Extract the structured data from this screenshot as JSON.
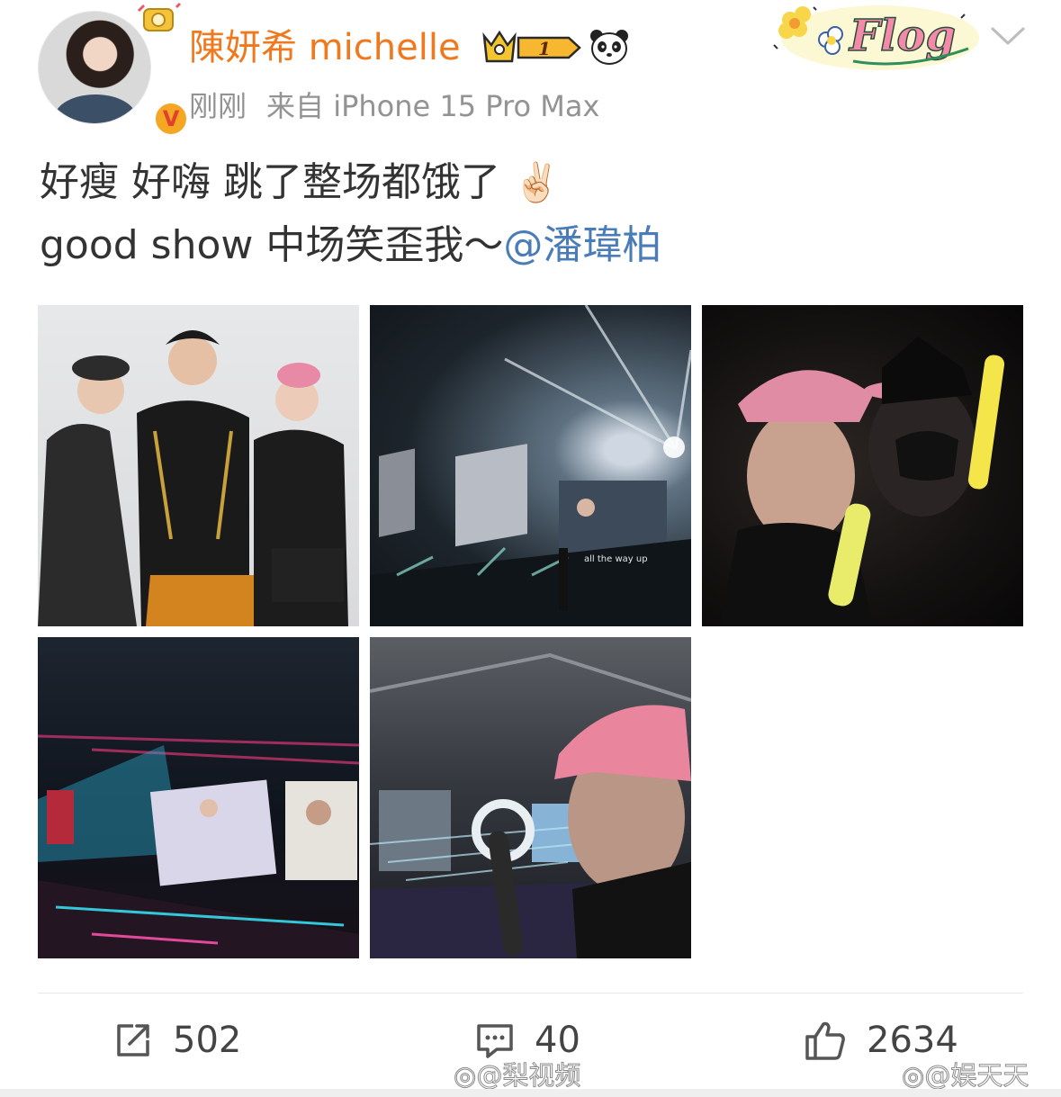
{
  "header": {
    "username": "陳妍希 michelle",
    "time": "刚刚",
    "source": "来自 iPhone 15 Pro Max",
    "vip_level": "1",
    "verified_badge": "V"
  },
  "post": {
    "line1": "好瘦 好嗨 跳了整场都饿了",
    "line1_emoji": "✌🏻",
    "line2": "good show 中场笑歪我～",
    "mention": "@潘瑋柏"
  },
  "photos": [
    {
      "name": "group-photo",
      "caption": ""
    },
    {
      "name": "concert-stage-photo",
      "caption": "all the way up"
    },
    {
      "name": "selfie-with-lightstick",
      "caption": ""
    },
    {
      "name": "stage-screens-photo",
      "caption": ""
    },
    {
      "name": "arena-selfie",
      "caption": ""
    }
  ],
  "actions": {
    "reposts": "502",
    "comments": "40",
    "likes": "2634"
  },
  "watermarks": {
    "left": "@梨视频",
    "right": "@娱天天"
  },
  "decorations": {
    "flog_label": "Flog"
  },
  "icons": {
    "share": "share-icon",
    "comment": "comment-icon",
    "like": "thumbs-up-icon",
    "dropdown": "chevron-down-icon",
    "panda": "panda-icon",
    "crown": "crown-icon"
  },
  "colors": {
    "username": "#f0781d",
    "meta": "#939393",
    "mention": "#4a7cb8",
    "text": "#333333",
    "verified": "#f5a623"
  }
}
